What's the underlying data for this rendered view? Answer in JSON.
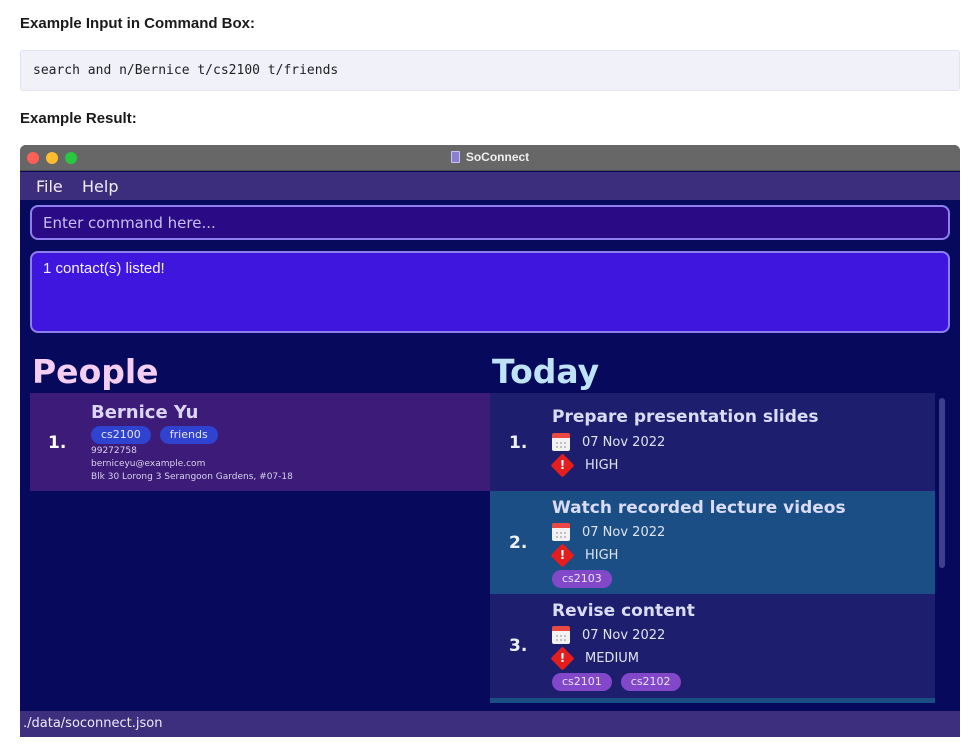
{
  "doc": {
    "input_heading": "Example Input in Command Box:",
    "command_example": "search and n/Bernice t/cs2100 t/friends",
    "result_heading": "Example Result:"
  },
  "window": {
    "title": "SoConnect",
    "menu": [
      "File",
      "Help"
    ]
  },
  "command": {
    "placeholder": "Enter command here...",
    "value": ""
  },
  "result": {
    "message": "1 contact(s) listed!"
  },
  "people": {
    "title": "People",
    "items": [
      {
        "index": "1.",
        "name": "Bernice Yu",
        "tags": [
          "cs2100",
          "friends"
        ],
        "phone": "99272758",
        "email": "berniceyu@example.com",
        "address": "Blk 30 Lorong 3 Serangoon Gardens, #07-18"
      }
    ]
  },
  "today": {
    "title": "Today",
    "tasks": [
      {
        "index": "1.",
        "title": "Prepare presentation slides",
        "date": "07 Nov 2022",
        "priority": "HIGH",
        "tags": []
      },
      {
        "index": "2.",
        "title": "Watch recorded lecture videos",
        "date": "07 Nov 2022",
        "priority": "HIGH",
        "tags": [
          "cs2103"
        ]
      },
      {
        "index": "3.",
        "title": "Revise content",
        "date": "07 Nov 2022",
        "priority": "MEDIUM",
        "tags": [
          "cs2101",
          "cs2102"
        ]
      }
    ]
  },
  "status": {
    "path": "./data/soconnect.json"
  },
  "colors": {
    "window_bg": "#070a5c",
    "menu_bg": "#3d2e7d",
    "result_bg": "#3e16de",
    "person_card_bg": "#3d1b79",
    "task_bg_odd": "#1d1e6e",
    "task_bg_even": "#1a4e85",
    "priority_red": "#e51d1d"
  }
}
